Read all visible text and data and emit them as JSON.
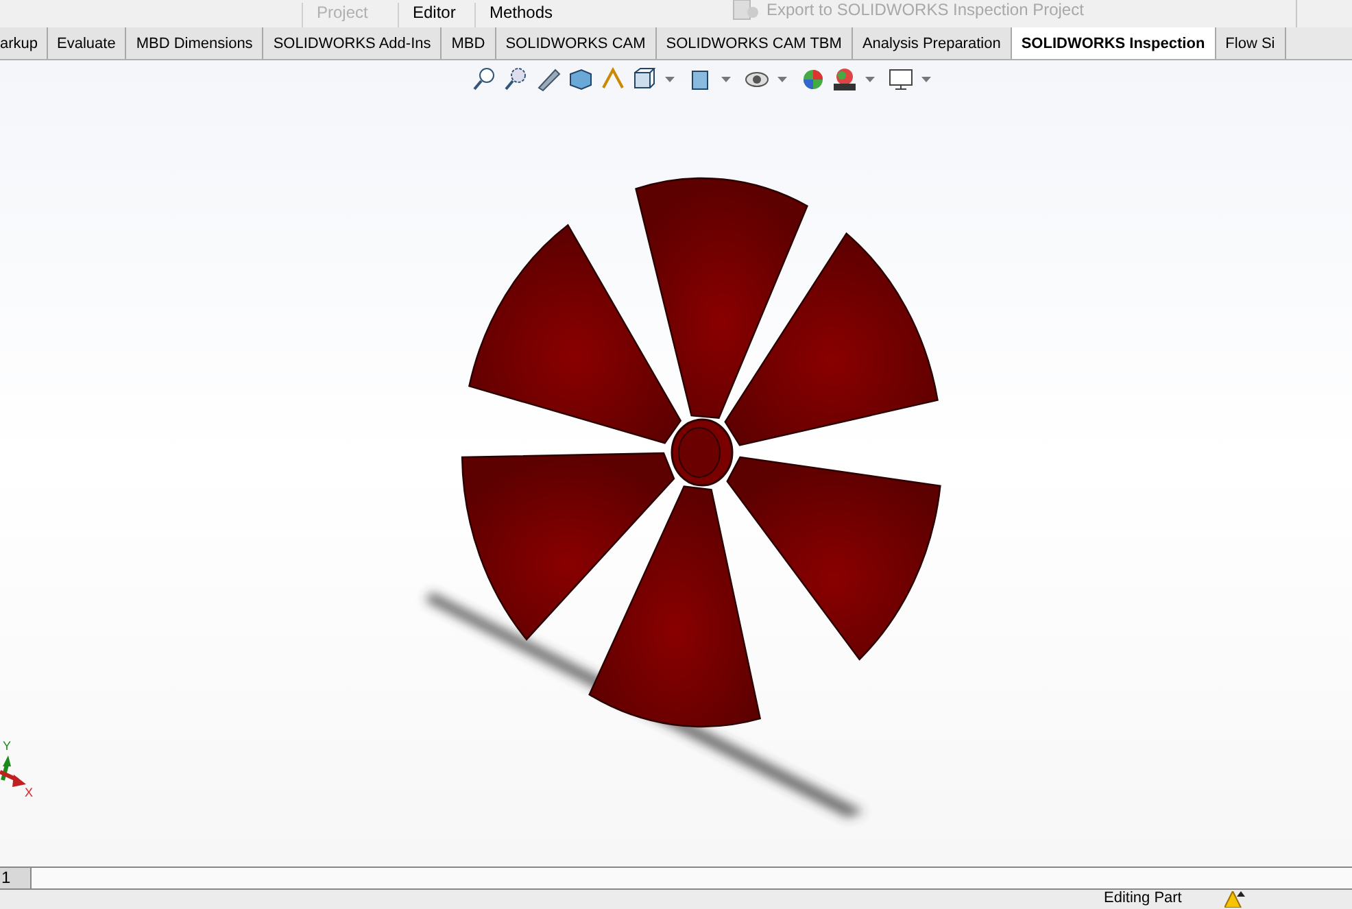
{
  "ribbon_top": {
    "items": [
      "Project",
      "Editor",
      "Methods"
    ],
    "export_command": "Export to SOLIDWORKS Inspection Project"
  },
  "tabs": [
    {
      "label": "arkup",
      "selected": false
    },
    {
      "label": "Evaluate",
      "selected": false
    },
    {
      "label": "MBD Dimensions",
      "selected": false
    },
    {
      "label": "SOLIDWORKS Add-Ins",
      "selected": false
    },
    {
      "label": "MBD",
      "selected": false
    },
    {
      "label": "SOLIDWORKS CAM",
      "selected": false
    },
    {
      "label": "SOLIDWORKS CAM TBM",
      "selected": false
    },
    {
      "label": "Analysis Preparation",
      "selected": false
    },
    {
      "label": "SOLIDWORKS Inspection",
      "selected": true
    },
    {
      "label": "Flow Si",
      "selected": false
    }
  ],
  "triad": {
    "y_label": "Y",
    "x_label": "X"
  },
  "sheet_tab": "1",
  "status_bar": {
    "text": "Editing Part"
  }
}
